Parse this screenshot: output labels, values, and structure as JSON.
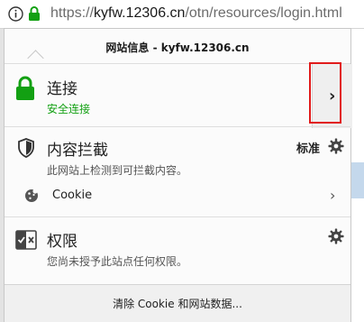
{
  "urlbar": {
    "url_prefix": "https://",
    "url_host": "kyfw.12306.cn",
    "url_path": "/otn/resources/login.html",
    "info_icon": "info-icon",
    "lock_icon": "lock-icon"
  },
  "panel": {
    "title": "网站信息 - kyfw.12306.cn",
    "connection": {
      "title": "连接",
      "subtitle": "安全连接",
      "more_icon": "chevron-right-icon"
    },
    "content_blocking": {
      "title": "内容拦截",
      "subtitle": "此网站上检测到可拦截内容。",
      "mode": "标准",
      "cookie_label": "Cookie"
    },
    "permissions": {
      "title": "权限",
      "subtitle": "您尚未授予此站点任何权限。"
    },
    "footer_button": "清除 Cookie 和网站数据..."
  },
  "colors": {
    "secure_green": "#12a012",
    "highlight_red": "#e11b1b"
  }
}
